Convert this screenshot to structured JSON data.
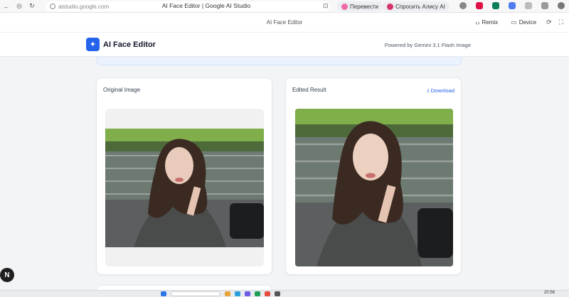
{
  "browser": {
    "address": "aistudio.google.com",
    "tab_title": "AI Face Editor | Google AI Studio",
    "pill_translate": "Перевести",
    "pill_alice": "Спросить Алису AI"
  },
  "studio": {
    "title": "AI Face Editor",
    "remix_label": "Remix",
    "device_label": "Device"
  },
  "app": {
    "title": "AI Face Editor",
    "powered_by": "Powered by Gemini 3.1 Flash Image"
  },
  "cards": {
    "original_label": "Original Image",
    "edited_label": "Edited Result",
    "download_label": "Download"
  },
  "taskbar": {
    "clock": "20:56"
  },
  "colors": {
    "accent": "#2563eb",
    "background": "#f3f4f6"
  }
}
